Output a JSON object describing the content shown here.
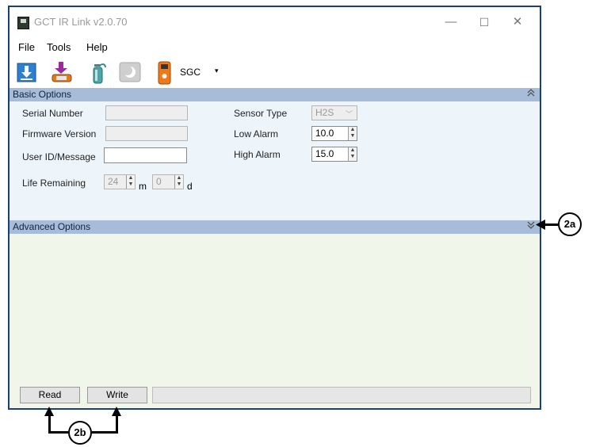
{
  "window": {
    "title": "GCT IR Link  v2.0.70",
    "controls": {
      "minimize": "—",
      "maximize": "☐",
      "close": "✕"
    }
  },
  "menu": [
    "File",
    "Tools",
    "Help"
  ],
  "toolbar": {
    "icons": [
      "download-icon",
      "upload-icon",
      "gas-cylinder-icon",
      "moon-icon",
      "gas-detector-icon"
    ],
    "device_label": "SGC",
    "device_arrow": "▾"
  },
  "basic_options": {
    "header": "Basic Options",
    "chevron": "≈",
    "serial_number_label": "Serial Number",
    "serial_number_value": "",
    "firmware_version_label": "Firmware Version",
    "firmware_version_value": "",
    "user_id_label": "User ID/Message",
    "user_id_value": "",
    "life_remaining_label": "Life Remaining",
    "life_months": "24",
    "life_months_unit": "m",
    "life_days": "0",
    "life_days_unit": "d",
    "sensor_type_label": "Sensor Type",
    "sensor_type_value": "H2S",
    "low_alarm_label": "Low Alarm",
    "low_alarm_value": "10.0",
    "high_alarm_label": "High Alarm",
    "high_alarm_value": "15.0"
  },
  "advanced_options": {
    "header": "Advanced Options",
    "chevron": "≫"
  },
  "buttons": {
    "read": "Read",
    "write": "Write"
  },
  "callouts": {
    "expand": "2a",
    "read_write": "2b"
  },
  "colors": {
    "window_border": "#1c3f78",
    "section_header": "#a7bcd8",
    "basic_body": "#eef5fa",
    "advanced_body": "#f0f7ea"
  }
}
